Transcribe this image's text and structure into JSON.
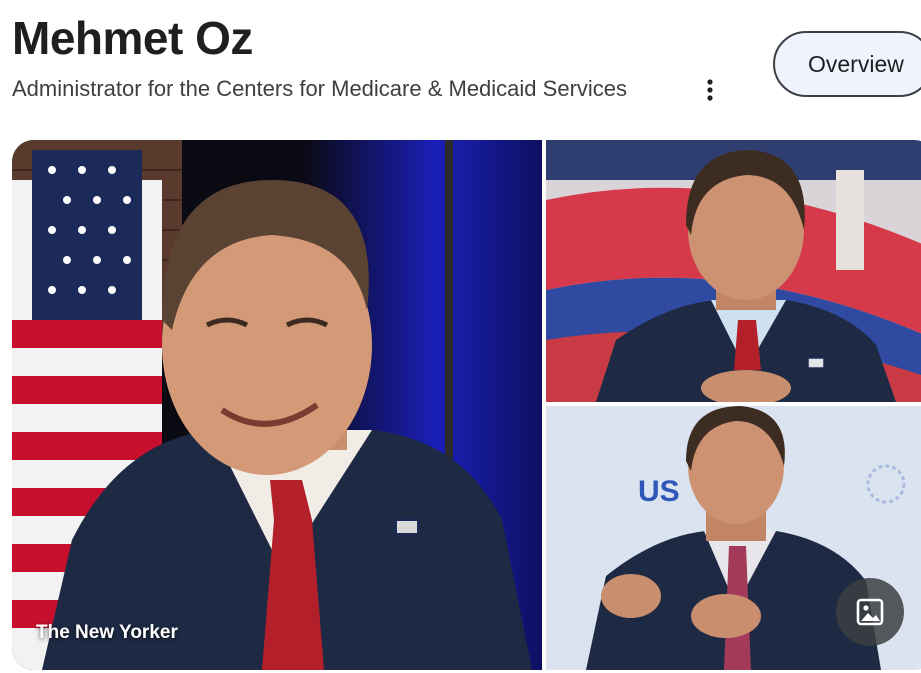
{
  "header": {
    "title": "Mehmet Oz",
    "subtitle": "Administrator for the Centers for Medicare & Medicaid Services",
    "more_icon": "more-vert-icon",
    "overview_label": "Overview"
  },
  "gallery": {
    "main": {
      "caption": "The New Yorker"
    },
    "bottom": {
      "backdrop_text": "US"
    },
    "image_search_icon": "image-icon"
  },
  "colors": {
    "chip_background": "#eef3fd",
    "suit": "#1e2a44",
    "tie": "#b3202a",
    "stage_blue": "#1a2bd0"
  }
}
